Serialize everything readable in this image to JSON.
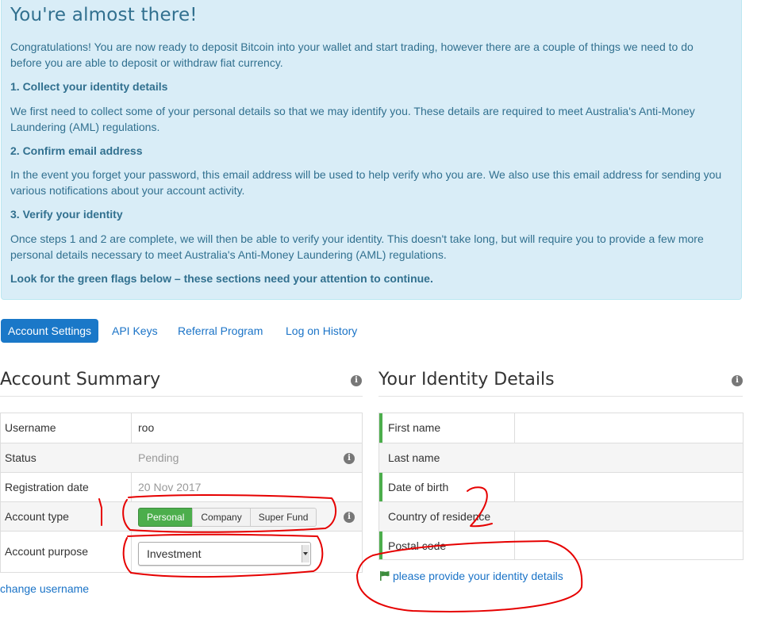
{
  "alert": {
    "title": "You're almost there!",
    "intro": "Congratulations! You are now ready to deposit Bitcoin into your wallet and start trading, however there are a couple of things we need to do before you are able to deposit or withdraw fiat currency.",
    "step1_title": "1. Collect your identity details",
    "step1_text": "We first need to collect some of your personal details so that we may identify you. These details are required to meet Australia's Anti-Money Laundering (AML) regulations.",
    "step2_title": "2. Confirm email address",
    "step2_text": "In the event you forget your password, this email address will be used to help verify who you are. We also use this email address for sending you various notifications about your account activity.",
    "step3_title": "3. Verify your identity",
    "step3_text": "Once steps 1 and 2 are complete, we will then be able to verify your identity. This doesn't take long, but will require you to provide a few more personal details necessary to meet Australia's Anti-Money Laundering (AML) regulations.",
    "footer": "Look for the green flags below – these sections need your attention to continue."
  },
  "tabs": [
    "Account Settings",
    "API Keys",
    "Referral Program",
    "Log on History"
  ],
  "account_summary": {
    "title": "Account Summary",
    "rows": {
      "username": {
        "label": "Username",
        "value": "roo"
      },
      "status": {
        "label": "Status",
        "value": "Pending"
      },
      "registration": {
        "label": "Registration date",
        "value": "20 Nov 2017"
      },
      "account_type": {
        "label": "Account type",
        "options": [
          "Personal",
          "Company",
          "Super Fund"
        ],
        "selected": "Personal"
      },
      "account_purpose": {
        "label": "Account purpose",
        "value": "Investment"
      }
    },
    "change_link": "change username"
  },
  "identity": {
    "title": "Your Identity Details",
    "rows": [
      "First name",
      "Last name",
      "Date of birth",
      "Country of residence",
      "Postal code"
    ],
    "flag_text": "please provide your identity details"
  },
  "colors": {
    "alert_bg": "#d9edf7",
    "alert_text": "#31708f",
    "link": "#1a73c7",
    "active_tab": "#1a78c8",
    "success": "#4cae4c",
    "annotation": "#e60000"
  }
}
